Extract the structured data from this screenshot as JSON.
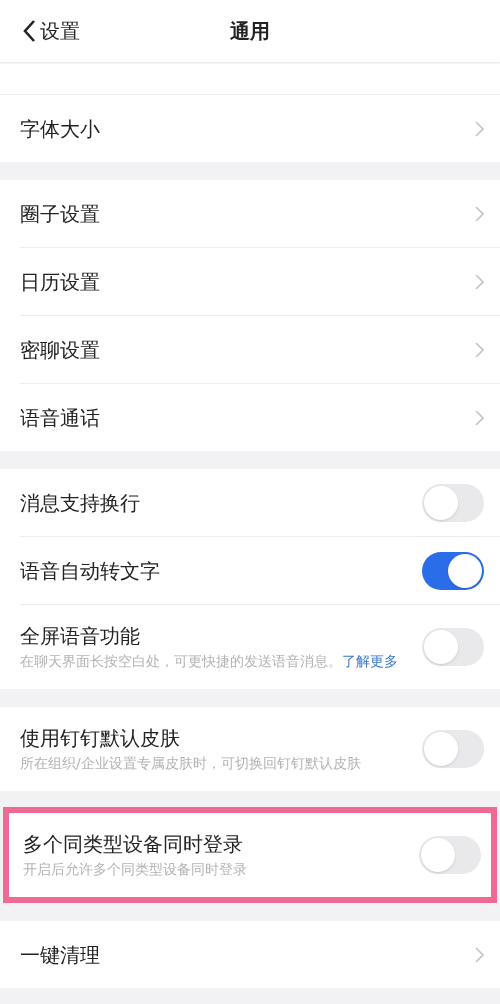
{
  "header": {
    "back_label": "设置",
    "title": "通用"
  },
  "sections": [
    {
      "items": [
        {
          "kind": "link",
          "label": "字体大小"
        }
      ]
    },
    {
      "items": [
        {
          "kind": "link",
          "label": "圈子设置"
        },
        {
          "kind": "link",
          "label": "日历设置"
        },
        {
          "kind": "link",
          "label": "密聊设置"
        },
        {
          "kind": "link",
          "label": "语音通话"
        }
      ]
    },
    {
      "items": [
        {
          "kind": "toggle",
          "label": "消息支持换行",
          "on": false
        },
        {
          "kind": "toggle",
          "label": "语音自动转文字",
          "on": true
        },
        {
          "kind": "toggle",
          "label": "全屏语音功能",
          "on": false,
          "description": "在聊天界面长按空白处，可更快捷的发送语音消息。",
          "link": "了解更多"
        }
      ]
    },
    {
      "items": [
        {
          "kind": "toggle",
          "label": "使用钉钉默认皮肤",
          "on": false,
          "description": "所在组织/企业设置专属皮肤时，可切换回钉钉默认皮肤"
        }
      ]
    },
    {
      "highlighted": true,
      "items": [
        {
          "kind": "toggle",
          "label": "多个同类型设备同时登录",
          "on": false,
          "description": "开启后允许多个同类型设备同时登录"
        }
      ]
    },
    {
      "items": [
        {
          "kind": "link",
          "label": "一键清理"
        }
      ]
    }
  ]
}
